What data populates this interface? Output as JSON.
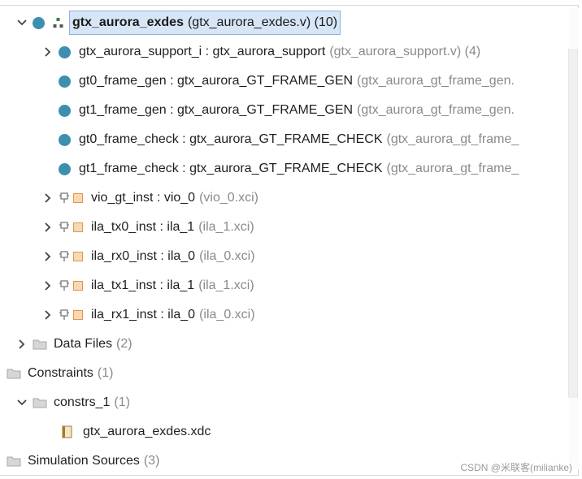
{
  "tree": {
    "root": {
      "name": "gtx_aurora_exdes",
      "detail": "(gtx_aurora_exdes.v) (10)"
    },
    "support": {
      "name": "gtx_aurora_support_i : gtx_aurora_support",
      "detail": "(gtx_aurora_support.v) (4)"
    },
    "gt0_frame_gen": {
      "name": "gt0_frame_gen : gtx_aurora_GT_FRAME_GEN",
      "detail": "(gtx_aurora_gt_frame_gen."
    },
    "gt1_frame_gen": {
      "name": "gt1_frame_gen : gtx_aurora_GT_FRAME_GEN",
      "detail": "(gtx_aurora_gt_frame_gen."
    },
    "gt0_frame_check": {
      "name": "gt0_frame_check : gtx_aurora_GT_FRAME_CHECK",
      "detail": "(gtx_aurora_gt_frame_"
    },
    "gt1_frame_check": {
      "name": "gt1_frame_check : gtx_aurora_GT_FRAME_CHECK",
      "detail": "(gtx_aurora_gt_frame_"
    },
    "vio": {
      "name": "vio_gt_inst : vio_0",
      "detail": "(vio_0.xci)"
    },
    "ila_tx0": {
      "name": "ila_tx0_inst : ila_1",
      "detail": "(ila_1.xci)"
    },
    "ila_rx0": {
      "name": "ila_rx0_inst : ila_0",
      "detail": "(ila_0.xci)"
    },
    "ila_tx1": {
      "name": "ila_tx1_inst : ila_1",
      "detail": "(ila_1.xci)"
    },
    "ila_rx1": {
      "name": "ila_rx1_inst : ila_0",
      "detail": "(ila_0.xci)"
    },
    "data_files": {
      "name": "Data Files",
      "detail": "(2)"
    },
    "constraints": {
      "name": "Constraints",
      "detail": "(1)"
    },
    "constrs_1": {
      "name": "constrs_1",
      "detail": "(1)"
    },
    "xdc": {
      "name": "gtx_aurora_exdes.xdc"
    },
    "sim_sources": {
      "name": "Simulation Sources",
      "detail": "(3)"
    }
  },
  "watermark": "CSDN @米联客(milianke)",
  "colors": {
    "module_dot": "#3d8fb0",
    "ip_box": "#e0954a",
    "selection": "#d7e6f6"
  }
}
